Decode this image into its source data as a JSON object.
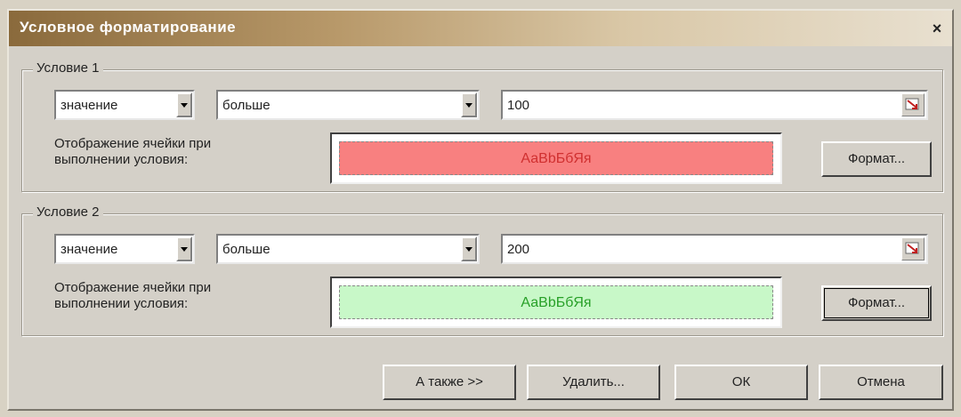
{
  "dialog": {
    "title": "Условное форматирование",
    "close_glyph": "×"
  },
  "conditions": [
    {
      "label": "Условие 1",
      "mode": "значение",
      "operator": "больше",
      "value": "100",
      "description_line1": "Отображение ячейки при",
      "description_line2": "выполнении условия:",
      "preview_text": "АаВbБбЯя",
      "preview_bg": "#f88080",
      "preview_fg": "#d03030",
      "format_button": "Формат..."
    },
    {
      "label": "Условие 2",
      "mode": "значение",
      "operator": "больше",
      "value": "200",
      "description_line1": "Отображение ячейки при",
      "description_line2": "выполнении условия:",
      "preview_text": "АаВbБбЯя",
      "preview_bg": "#c8f8c8",
      "preview_fg": "#28a028",
      "format_button": "Формат..."
    }
  ],
  "footer": {
    "also_button": "А также >>",
    "delete_button": "Удалить...",
    "ok_button": "ОК",
    "cancel_button": "Отмена"
  },
  "icons": {
    "close": "close-icon",
    "dropdown": "chevron-down-icon",
    "range_select": "collapse-dialog-icon"
  }
}
